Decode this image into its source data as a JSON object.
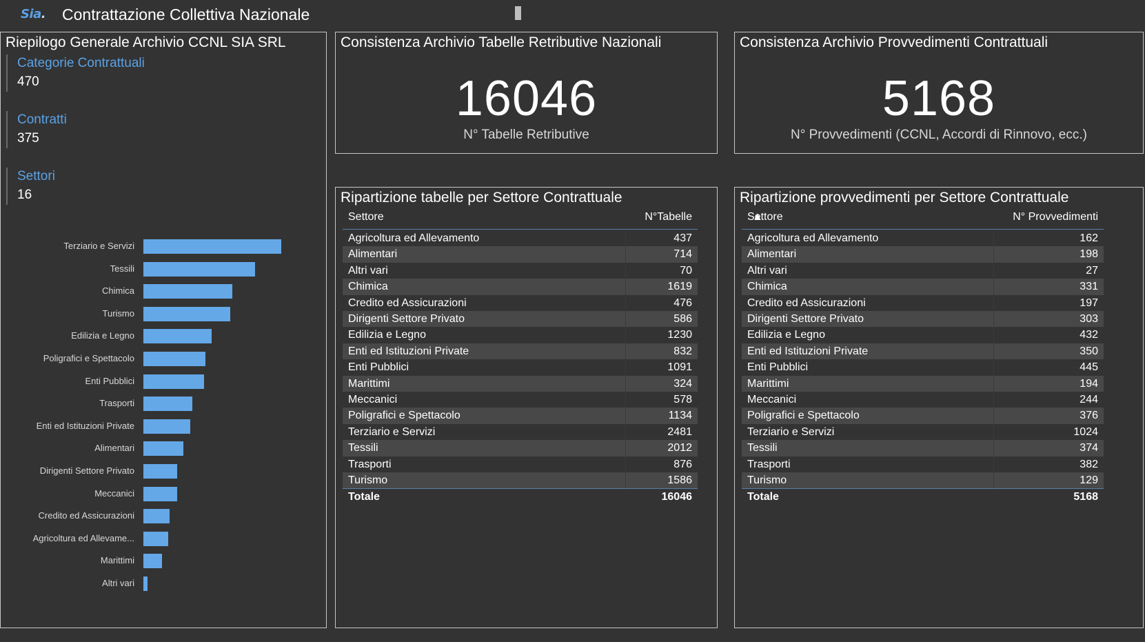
{
  "header": {
    "logo_text": "Sia",
    "logo_dot": ".",
    "title": "Contrattazione Collettiva Nazionale"
  },
  "summary": {
    "title": "Riepilogo Generale Archivio CCNL SIA SRL",
    "kpis": [
      {
        "label": "Categorie Contrattuali",
        "value": "470"
      },
      {
        "label": "Contratti",
        "value": "375"
      },
      {
        "label": "Settori",
        "value": "16"
      }
    ]
  },
  "chart_data": {
    "type": "bar",
    "orientation": "horizontal",
    "categories": [
      "Terziario e Servizi",
      "Tessili",
      "Chimica",
      "Turismo",
      "Edilizia e Legno",
      "Poligrafici e Spettacolo",
      "Enti Pubblici",
      "Trasporti",
      "Enti ed Istituzioni Private",
      "Alimentari",
      "Dirigenti Settore Privato",
      "Meccanici",
      "Credito ed Assicurazioni",
      "Agricoltura ed Allevame...",
      "Marittimi",
      "Altri vari"
    ],
    "values": [
      73,
      59,
      47,
      46,
      36,
      33,
      32,
      26,
      25,
      21,
      18,
      18,
      14,
      13,
      10,
      2
    ],
    "xlim": [
      0,
      73
    ],
    "grid": false,
    "bar_color": "#64a8e8"
  },
  "card_tabelle": {
    "title": "Consistenza Archivio Tabelle Retributive Nazionali",
    "value": "16046",
    "caption": "N° Tabelle Retributive"
  },
  "card_provvedimenti": {
    "title": "Consistenza Archivio Provvedimenti Contrattuali",
    "value": "5168",
    "caption": "N° Provvedimenti (CCNL, Accordi di Rinnovo, ecc.)"
  },
  "table_tabelle": {
    "title": "Ripartizione tabelle per Settore Contrattuale",
    "col1": "Settore",
    "col2": "N°Tabelle",
    "rows": [
      [
        "Agricoltura ed Allevamento",
        "437"
      ],
      [
        "Alimentari",
        "714"
      ],
      [
        "Altri vari",
        "70"
      ],
      [
        "Chimica",
        "1619"
      ],
      [
        "Credito ed Assicurazioni",
        "476"
      ],
      [
        "Dirigenti Settore Privato",
        "586"
      ],
      [
        "Edilizia e Legno",
        "1230"
      ],
      [
        "Enti ed Istituzioni Private",
        "832"
      ],
      [
        "Enti Pubblici",
        "1091"
      ],
      [
        "Marittimi",
        "324"
      ],
      [
        "Meccanici",
        "578"
      ],
      [
        "Poligrafici e Spettacolo",
        "1134"
      ],
      [
        "Terziario e Servizi",
        "2481"
      ],
      [
        "Tessili",
        "2012"
      ],
      [
        "Trasporti",
        "876"
      ],
      [
        "Turismo",
        "1586"
      ]
    ],
    "total_label": "Totale",
    "total_value": "16046"
  },
  "table_provvedimenti": {
    "title": "Ripartizione provvedimenti per Settore Contrattuale",
    "col1": "Settore",
    "col2": "N° Provvedimenti",
    "sort_indicator": "▲",
    "rows": [
      [
        "Agricoltura ed Allevamento",
        "162"
      ],
      [
        "Alimentari",
        "198"
      ],
      [
        "Altri vari",
        "27"
      ],
      [
        "Chimica",
        "331"
      ],
      [
        "Credito ed Assicurazioni",
        "197"
      ],
      [
        "Dirigenti Settore Privato",
        "303"
      ],
      [
        "Edilizia e Legno",
        "432"
      ],
      [
        "Enti ed Istituzioni Private",
        "350"
      ],
      [
        "Enti Pubblici",
        "445"
      ],
      [
        "Marittimi",
        "194"
      ],
      [
        "Meccanici",
        "244"
      ],
      [
        "Poligrafici e Spettacolo",
        "376"
      ],
      [
        "Terziario e Servizi",
        "1024"
      ],
      [
        "Tessili",
        "374"
      ],
      [
        "Trasporti",
        "382"
      ],
      [
        "Turismo",
        "129"
      ]
    ],
    "total_label": "Totale",
    "total_value": "5168"
  }
}
